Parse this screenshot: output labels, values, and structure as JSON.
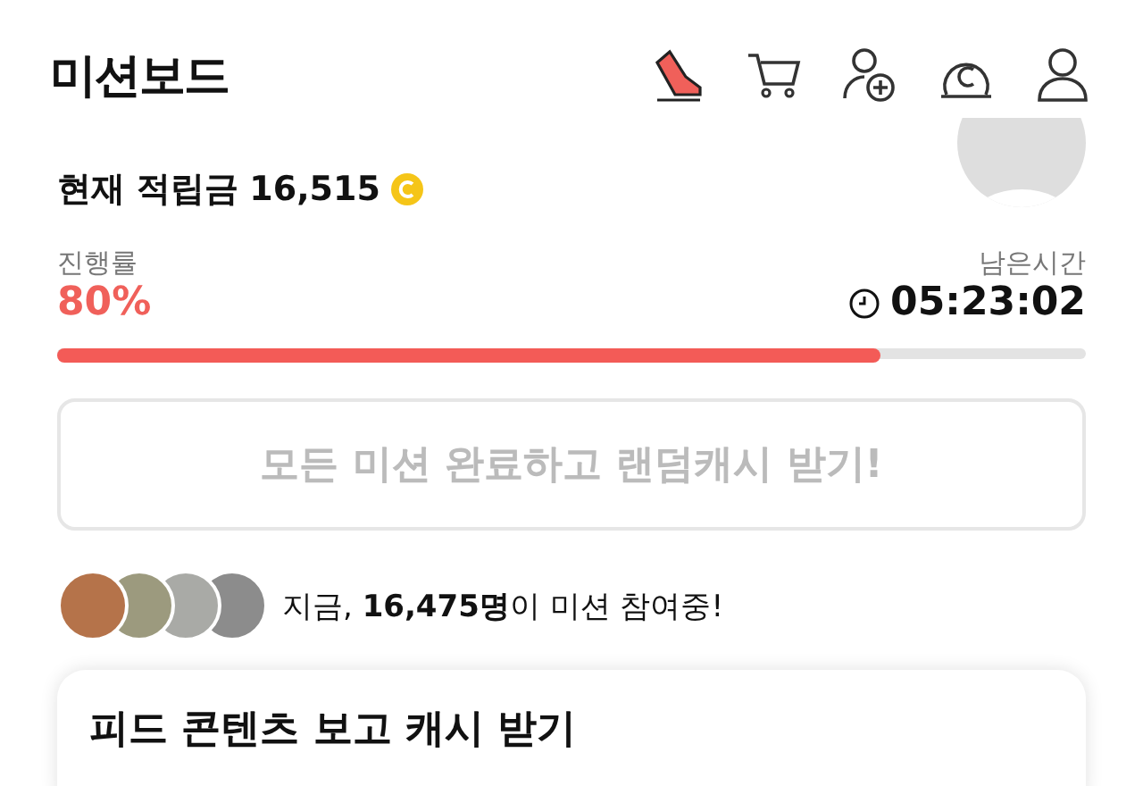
{
  "header": {
    "title": "미션보드"
  },
  "balance": {
    "label": "현재 적립금",
    "amount": "16,515"
  },
  "progress": {
    "label": "진행률",
    "percent": "80%",
    "level": 0.8,
    "remaining_label": "남은시간",
    "remaining": "05:23:02"
  },
  "reward_button": {
    "label": "모든 미션 완료하고 랜덤캐시 받기!",
    "disabled": true
  },
  "participants": {
    "text": "지금, **16,475명**이 미션 참여중!"
  },
  "feed_card": {
    "title": "피드 콘텐츠 보고 캐시 받기"
  }
}
